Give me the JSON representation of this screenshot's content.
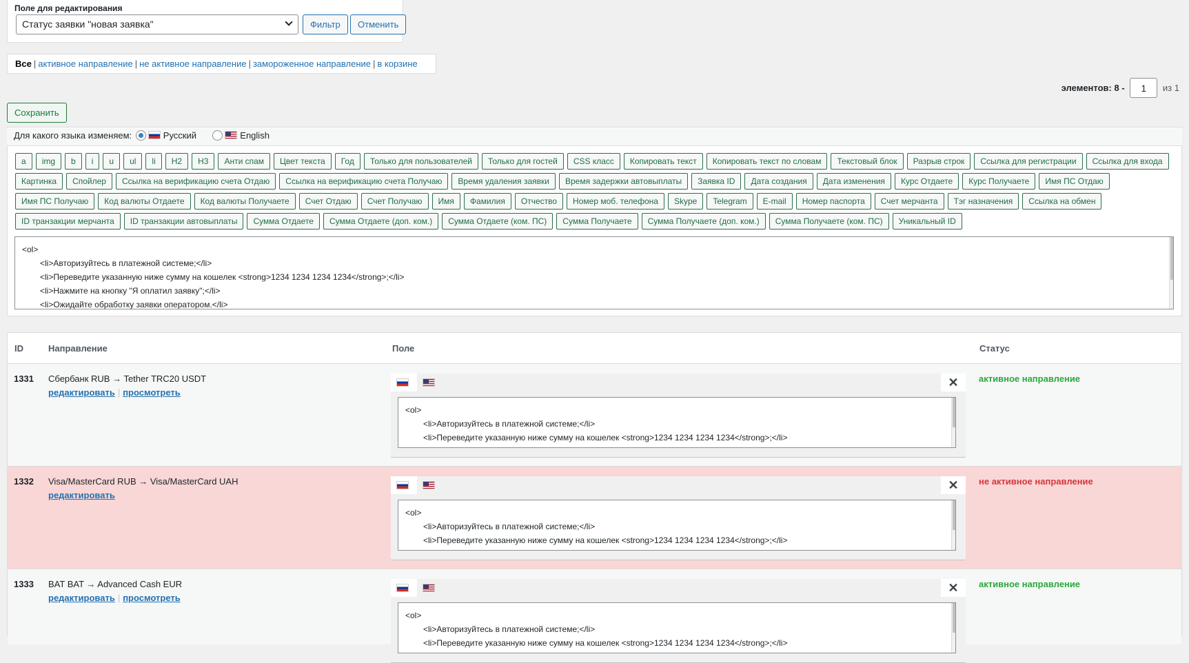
{
  "filter": {
    "label": "Поле для редактирования",
    "selected": "Статус заявки \"новая заявка\"",
    "filter_btn": "Фильтр",
    "cancel_btn": "Отменить"
  },
  "status_links": {
    "all": "Все",
    "active": "активное направление",
    "inactive": "не активное направление",
    "frozen": "замороженное направление",
    "trash": "в корзине"
  },
  "pager": {
    "label": "элементов: 8 -",
    "page": "1",
    "of": "из",
    "total": "1"
  },
  "save_btn": "Сохранить",
  "lang": {
    "question": "Для какого языка изменяем:",
    "ru": "Русский",
    "en": "English"
  },
  "tags": [
    "a",
    "img",
    "b",
    "i",
    "u",
    "ul",
    "li",
    "H2",
    "H3",
    "Анти спам",
    "Цвет текста",
    "Год",
    "Только для пользователей",
    "Только для гостей",
    "CSS класс",
    "Копировать текст",
    "Копировать текст по словам",
    "Текстовый блок",
    "Разрыв строк",
    "Ссылка для регистрации",
    "Ссылка для входа",
    "Картинка",
    "Спойлер",
    "Ссылка на верификацию счета Отдаю",
    "Ссылка на верификацию счета Получаю",
    "Время удаления заявки",
    "Время задержки автовыплаты",
    "Заявка ID",
    "Дата создания",
    "Дата изменения",
    "Курс Отдаете",
    "Курс Получаете",
    "Имя ПС Отдаю",
    "Имя ПС Получаю",
    "Код валюты Отдаете",
    "Код валюты Получаете",
    "Счет Отдаю",
    "Счет Получаю",
    "Имя",
    "Фамилия",
    "Отчество",
    "Номер моб. телефона",
    "Skype",
    "Telegram",
    "E-mail",
    "Номер паспорта",
    "Счет мерчанта",
    "Тэг назначения",
    "Ссылка на обмен",
    "ID транзакции мерчанта",
    "ID транзакции автовыплаты",
    "Сумма Отдаете",
    "Сумма Отдаете (доп. ком.)",
    "Сумма Отдаете (ком. ПС)",
    "Сумма Получаете",
    "Сумма Получаете (доп. ком.)",
    "Сумма Получаете (ком. ПС)",
    "Уникальный ID"
  ],
  "editor_lines": [
    "<ol>",
    "<li>Авторизуйтесь в платежной системе;</li>",
    "<li>Переведите указанную ниже сумму на кошелек <strong>1234 1234 1234 1234</strong>;</li>",
    "<li>Нажмите на кнопку \"Я оплатил заявку\";</li>",
    "<li>Ожидайте обработку заявки оператором.</li>"
  ],
  "table": {
    "headers": {
      "id": "ID",
      "direction": "Направление",
      "field": "Поле",
      "status": "Статус"
    },
    "rows": [
      {
        "id": "1331",
        "direction": "Сбербанк RUB → Tether TRC20 USDT",
        "edit": "редактировать",
        "view": "просмотреть",
        "status": "активное направление"
      },
      {
        "id": "1332",
        "direction": "Visa/MasterCard RUB → Visa/MasterCard UAH",
        "edit": "редактировать",
        "status": "не активное направление"
      },
      {
        "id": "1333",
        "direction": "BAT BAT → Advanced Cash EUR",
        "edit": "редактировать",
        "view": "просмотреть",
        "status": "активное направление"
      }
    ],
    "cell_lines": [
      "<ol>",
      "<li>Авторизуйтесь в платежной системе;</li>",
      "<li>Переведите указанную ниже сумму на кошелек <strong>1234 1234 1234 1234</strong>;</li>"
    ],
    "close_glyph": "✕"
  },
  "colors": {
    "accent": "#2271b1",
    "active": "#2aa83a",
    "inactive": "#d63638",
    "inactive_row": "#f9d7d7"
  }
}
